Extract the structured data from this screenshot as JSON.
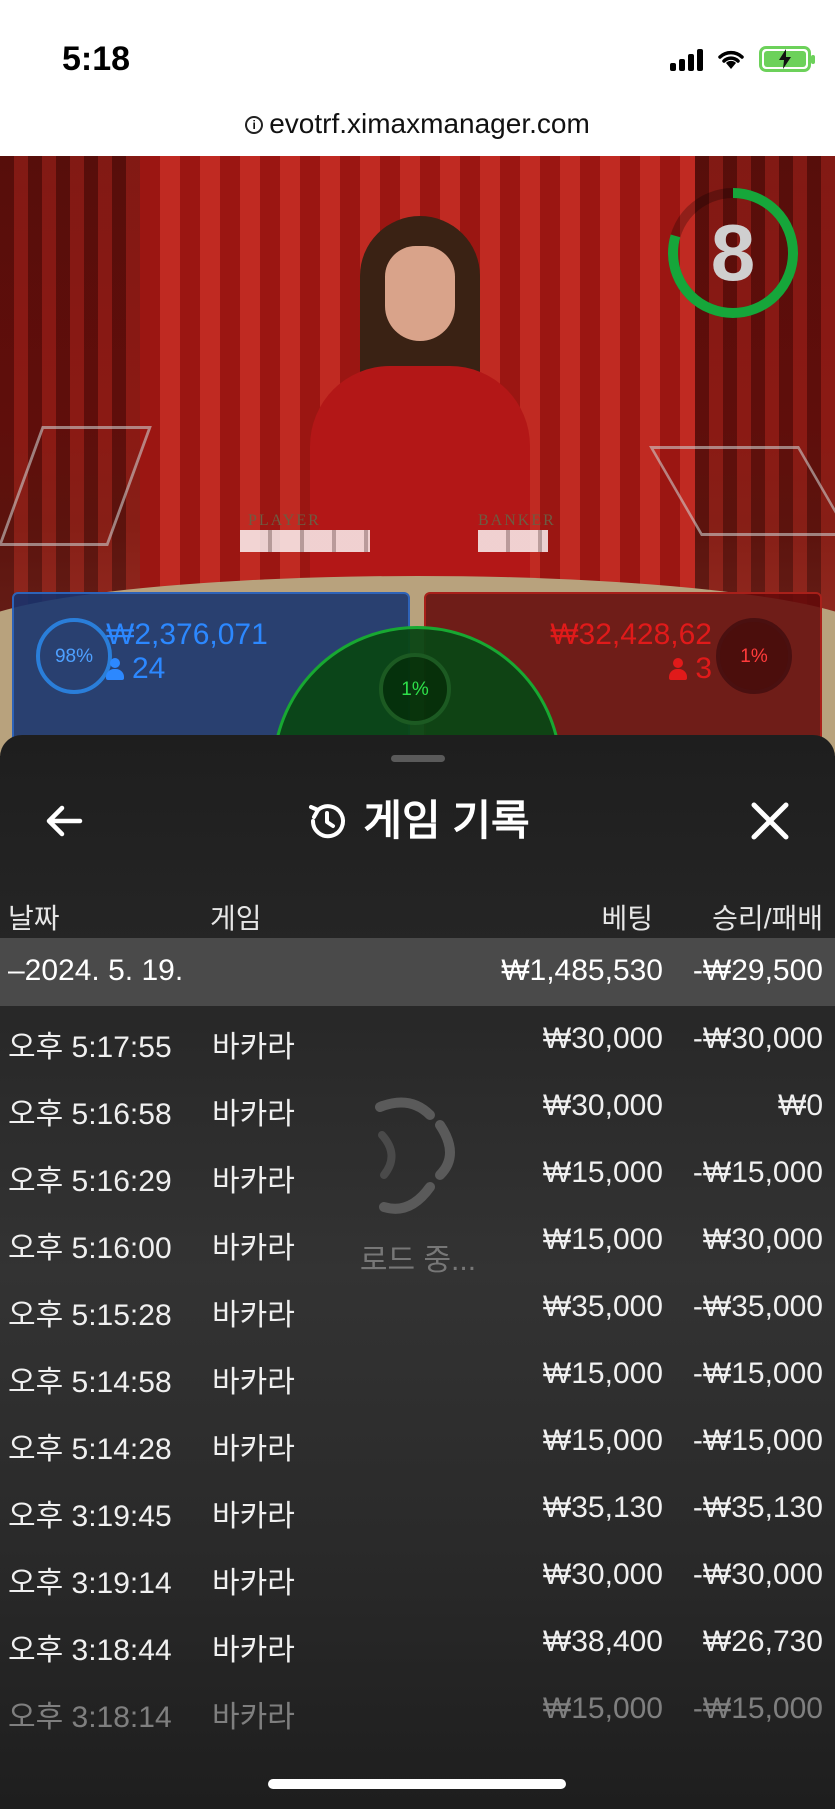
{
  "status_bar": {
    "time": "5:18"
  },
  "browser": {
    "url": "evotrf.ximaxmanager.com",
    "info_icon": "info-icon"
  },
  "video": {
    "timer_value": "8",
    "table_labels": {
      "player": "PLAYER",
      "banker": "BANKER"
    },
    "player_bet": {
      "percent": "98%",
      "amount": "₩2,376,071",
      "count": "24",
      "color": "#2c88ff"
    },
    "banker_bet": {
      "percent": "1%",
      "amount": "₩32,428,62",
      "count": "3",
      "color": "#e01a1a"
    },
    "tie_bet": {
      "percent": "1%",
      "color": "#2ee04a"
    }
  },
  "sheet": {
    "title": "게임 기록",
    "columns": {
      "date": "날짜",
      "game": "게임",
      "bet": "베팅",
      "win_loss": "승리/패배"
    },
    "summary": {
      "date": "–2024. 5. 19.",
      "bet": "₩1,485,530",
      "win_loss": "-₩29,500"
    },
    "rows": [
      {
        "time": "오후 5:17:55",
        "game": "바카라",
        "bet": "₩30,000",
        "win_loss": "-₩30,000"
      },
      {
        "time": "오후 5:16:58",
        "game": "바카라",
        "bet": "₩30,000",
        "win_loss": "₩0"
      },
      {
        "time": "오후 5:16:29",
        "game": "바카라",
        "bet": "₩15,000",
        "win_loss": "-₩15,000"
      },
      {
        "time": "오후 5:16:00",
        "game": "바카라",
        "bet": "₩15,000",
        "win_loss": "₩30,000"
      },
      {
        "time": "오후 5:15:28",
        "game": "바카라",
        "bet": "₩35,000",
        "win_loss": "-₩35,000"
      },
      {
        "time": "오후 5:14:58",
        "game": "바카라",
        "bet": "₩15,000",
        "win_loss": "-₩15,000"
      },
      {
        "time": "오후 5:14:28",
        "game": "바카라",
        "bet": "₩15,000",
        "win_loss": "-₩15,000"
      },
      {
        "time": "오후 3:19:45",
        "game": "바카라",
        "bet": "₩35,130",
        "win_loss": "-₩35,130"
      },
      {
        "time": "오후 3:19:14",
        "game": "바카라",
        "bet": "₩30,000",
        "win_loss": "-₩30,000"
      },
      {
        "time": "오후 3:18:44",
        "game": "바카라",
        "bet": "₩38,400",
        "win_loss": "₩26,730"
      },
      {
        "time": "오후 3:18:14",
        "game": "바카라",
        "bet": "₩15,000",
        "win_loss": "-₩15,000"
      }
    ],
    "loading_text": "로드 중..."
  },
  "colors": {
    "accent_green": "#18a832",
    "player_blue": "#2a7ed9",
    "banker_red": "#a8201a"
  }
}
